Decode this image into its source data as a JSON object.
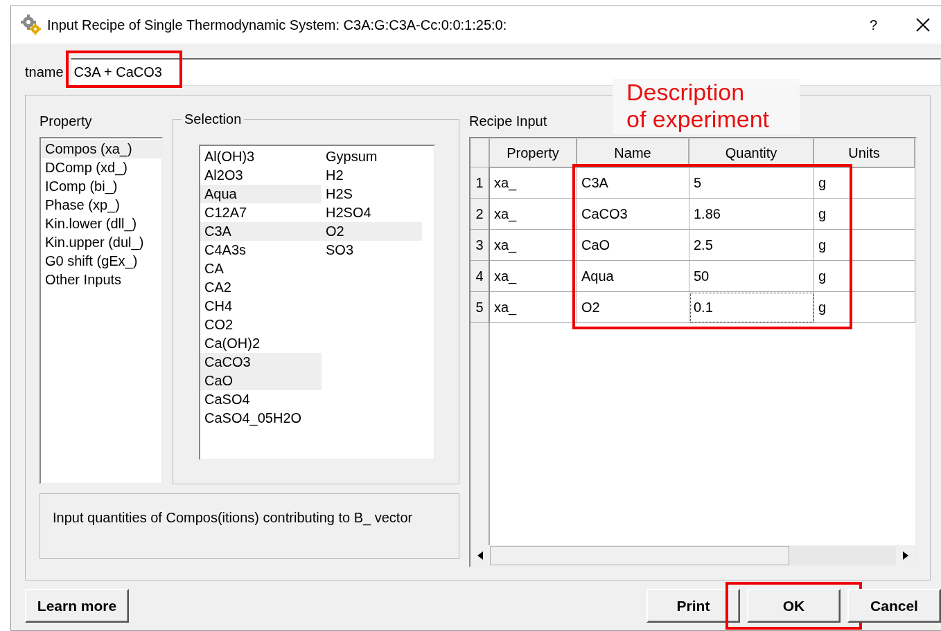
{
  "window": {
    "title": "Input Recipe of Single Thermodynamic System: C3A:G:C3A-Cc:0:0:1:25:0:",
    "help": "?"
  },
  "tname": {
    "label": "tname",
    "value": "C3A + CaCO3",
    "highlighted": true
  },
  "property": {
    "label": "Property",
    "items": [
      {
        "label": "Compos (xa_)",
        "selected": true
      },
      {
        "label": "DComp (xd_)",
        "selected": false
      },
      {
        "label": "IComp (bi_)",
        "selected": false
      },
      {
        "label": "Phase (xp_)",
        "selected": false
      },
      {
        "label": "Kin.lower (dll_)",
        "selected": false
      },
      {
        "label": "Kin.upper (dul_)",
        "selected": false
      },
      {
        "label": "G0 shift (gEx_)",
        "selected": false
      },
      {
        "label": "Other Inputs",
        "selected": false
      }
    ]
  },
  "selection": {
    "label": "Selection",
    "items": [
      {
        "label": "Al(OH)3",
        "selected": false
      },
      {
        "label": "Al2O3",
        "selected": false
      },
      {
        "label": "Aqua",
        "selected": true
      },
      {
        "label": "C12A7",
        "selected": false
      },
      {
        "label": "C3A",
        "selected": true
      },
      {
        "label": "C4A3s",
        "selected": false
      },
      {
        "label": "CA",
        "selected": false
      },
      {
        "label": "CA2",
        "selected": false
      },
      {
        "label": "CH4",
        "selected": false
      },
      {
        "label": "CO2",
        "selected": false
      },
      {
        "label": "Ca(OH)2",
        "selected": false
      },
      {
        "label": "CaCO3",
        "selected": true
      },
      {
        "label": "CaO",
        "selected": true
      },
      {
        "label": "CaSO4",
        "selected": false
      },
      {
        "label": "CaSO4_05H2O",
        "selected": false
      },
      {
        "label": "Gypsum",
        "selected": false
      },
      {
        "label": "H2",
        "selected": false
      },
      {
        "label": "H2S",
        "selected": false
      },
      {
        "label": "H2SO4",
        "selected": false
      },
      {
        "label": "O2",
        "selected": true
      },
      {
        "label": "SO3",
        "selected": false
      }
    ]
  },
  "info": "Input quantities of Compos(itions) contributing to B_ vector",
  "recipe": {
    "label": "Recipe Input",
    "highlighted": true,
    "columns": [
      {
        "label": "Property"
      },
      {
        "label": "Name"
      },
      {
        "label": "Quantity"
      },
      {
        "label": "Units"
      }
    ],
    "rows": [
      {
        "number": "1",
        "property": "xa_",
        "name": "C3A",
        "quantity": "5",
        "units": "g",
        "focused": false
      },
      {
        "number": "2",
        "property": "xa_",
        "name": "CaCO3",
        "quantity": "1.86",
        "units": "g",
        "focused": false
      },
      {
        "number": "3",
        "property": "xa_",
        "name": "CaO",
        "quantity": "2.5",
        "units": "g",
        "focused": false
      },
      {
        "number": "4",
        "property": "xa_",
        "name": "Aqua",
        "quantity": "50",
        "units": "g",
        "focused": false
      },
      {
        "number": "5",
        "property": "xa_",
        "name": "O2",
        "quantity": "0.1",
        "units": "g",
        "focused": true
      }
    ]
  },
  "buttons": [
    {
      "label": "Learn more",
      "highlighted": false
    },
    {
      "label": "Print",
      "highlighted": false
    },
    {
      "label": "OK",
      "highlighted": true
    },
    {
      "label": "Cancel",
      "highlighted": false
    }
  ],
  "annotation": "Description\nof experiment"
}
